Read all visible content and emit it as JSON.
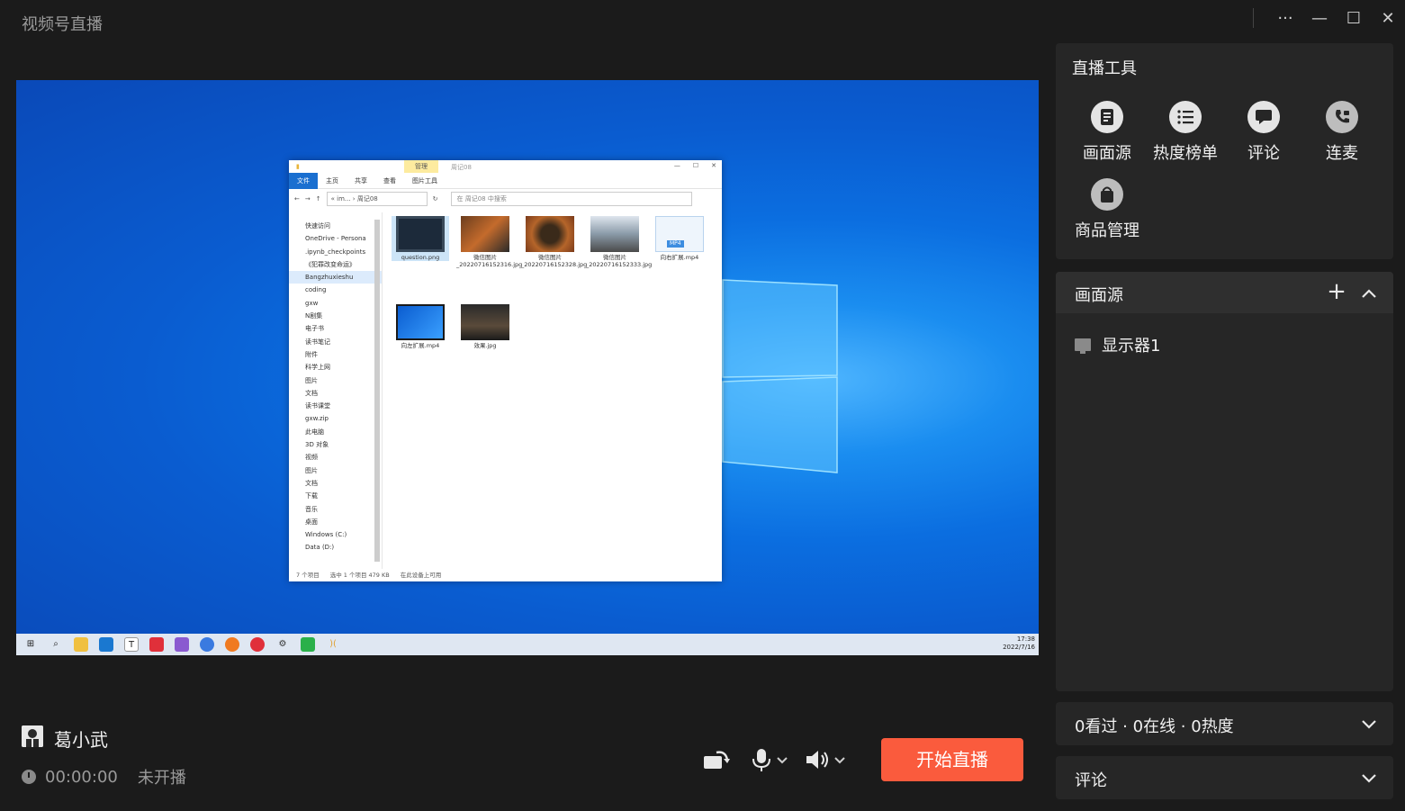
{
  "app": {
    "title": "视频号直播"
  },
  "window": {
    "more": "···",
    "minimize": "—",
    "maximize": "☐",
    "close": "✕"
  },
  "preview": {
    "explorer": {
      "manage_tab": "管理",
      "window_title": "周记08",
      "ribbon_tabs": [
        "文件",
        "主页",
        "共享",
        "查看",
        "图片工具"
      ],
      "path": "« im... › 周记08",
      "search_placeholder": "在 周记08 中搜索",
      "nav_items": [
        "快速访问",
        "OneDrive - Persona",
        ".ipynb_checkpoints",
        "《犯罪改变命运》",
        "Bangzhuxieshu",
        "coding",
        "gxw",
        "N剧集",
        "电子书",
        "读书笔记",
        "附件",
        "科学上网",
        "图片",
        "文档",
        "读书课堂",
        "gxw.zip",
        "此电脑",
        "3D 对象",
        "视频",
        "图片",
        "文档",
        "下载",
        "音乐",
        "桌面",
        "Windows (C:)",
        "Data (D:)"
      ],
      "files": [
        {
          "name": "question.png"
        },
        {
          "name": "微信图片_20220716152316.jpg"
        },
        {
          "name": "微信图片_20220716152328.jpg"
        },
        {
          "name": "微信图片_20220716152333.jpg"
        },
        {
          "name": "向右扩展.mp4"
        },
        {
          "name": "向左扩展.mp4"
        },
        {
          "name": "效果.jpg"
        }
      ],
      "mp4_badge": "MP4",
      "status": [
        "7 个项目",
        "选中 1 个项目  479 KB",
        "在此设备上可用"
      ]
    },
    "taskbar": {
      "time": "17:38",
      "date": "2022/7/16"
    }
  },
  "presenter": {
    "name": "葛小武",
    "timer": "00:00:00",
    "status": "未开播"
  },
  "start_button": "开始直播",
  "tools": {
    "title": "直播工具",
    "items": [
      {
        "label": "画面源",
        "icon": "document-icon"
      },
      {
        "label": "热度榜单",
        "icon": "list-icon"
      },
      {
        "label": "评论",
        "icon": "comment-icon"
      },
      {
        "label": "连麦",
        "icon": "phone-icon"
      },
      {
        "label": "商品管理",
        "icon": "bag-icon"
      }
    ]
  },
  "sources": {
    "title": "画面源",
    "add": "+",
    "items": [
      {
        "label": "显示器1"
      }
    ]
  },
  "stats": {
    "text": "0看过 · 0在线 · 0热度"
  },
  "comments": {
    "title": "评论"
  },
  "colors": {
    "accent": "#fa5b3d",
    "panel": "#262626",
    "background": "#1b1b1b"
  }
}
